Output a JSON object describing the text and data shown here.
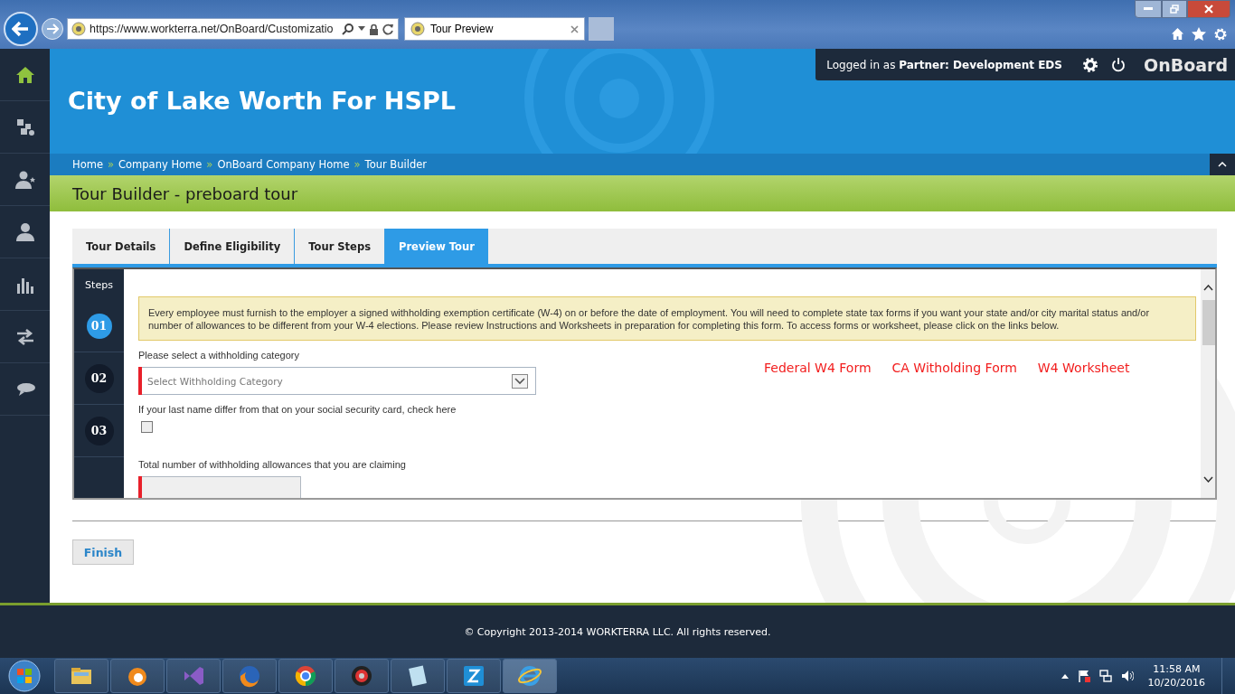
{
  "browser": {
    "address": "https://www.workterra.net/OnBoard/Customizatio",
    "tab_title": "Tour Preview"
  },
  "sidebar": {
    "items": [
      {
        "kind": "home",
        "selected": true
      },
      {
        "kind": "puzzle",
        "selected": false
      },
      {
        "kind": "user-star",
        "selected": false
      },
      {
        "kind": "user",
        "selected": false
      },
      {
        "kind": "chart",
        "selected": false
      },
      {
        "kind": "arrows",
        "selected": false
      },
      {
        "kind": "chat",
        "selected": false
      }
    ]
  },
  "header": {
    "title": "City of Lake Worth For HSPL",
    "login": "Logged in as **Partner:  Development EDS**",
    "brand": "OnBoard"
  },
  "breadcrumb": {
    "separator": "»",
    "items": [
      "Home",
      "Company Home",
      "OnBoard Company Home",
      "Tour Builder"
    ]
  },
  "page_title": "Tour Builder - preboard tour",
  "tabs": [
    {
      "label": "Tour Details",
      "selected": false
    },
    {
      "label": "Define Eligibility",
      "selected": false
    },
    {
      "label": "Tour Steps",
      "selected": false
    },
    {
      "label": "Preview Tour",
      "selected": true
    }
  ],
  "steps": {
    "heading": "Steps",
    "items": [
      {
        "label": "01",
        "selected": true
      },
      {
        "label": "02",
        "selected": false
      },
      {
        "label": "03",
        "selected": false
      }
    ]
  },
  "form": {
    "notice": "Every employee must furnish to the employer a signed withholding exemption certificate (W-4) on or before the date of employment. You will need to complete state tax forms if you want your state and/or city marital status and/or number of allowances to be different from your W-4 elections. Please review Instructions and Worksheets in preparation for completing this form. To access forms or worksheet, please click on the links below.",
    "links": [
      "Federal W4 Form",
      "CA Witholding Form",
      "W4 Worksheet"
    ],
    "fields": [
      {
        "kind": "select",
        "label": "Please select a withholding category",
        "placeholder": "Select Withholding Category",
        "required": true
      },
      {
        "kind": "checkbox",
        "label": "If your last name differ from that on your social security card, check here",
        "checked": false
      },
      {
        "kind": "text",
        "label": "Total number of withholding allowances that you are claiming",
        "required": true
      }
    ]
  },
  "finish_button": "Finish",
  "footer": "© Copyright 2013-2014 WORKTERRA LLC. All rights reserved.",
  "taskbar": {
    "time": "11:58 AM",
    "date": "10/20/2016"
  }
}
